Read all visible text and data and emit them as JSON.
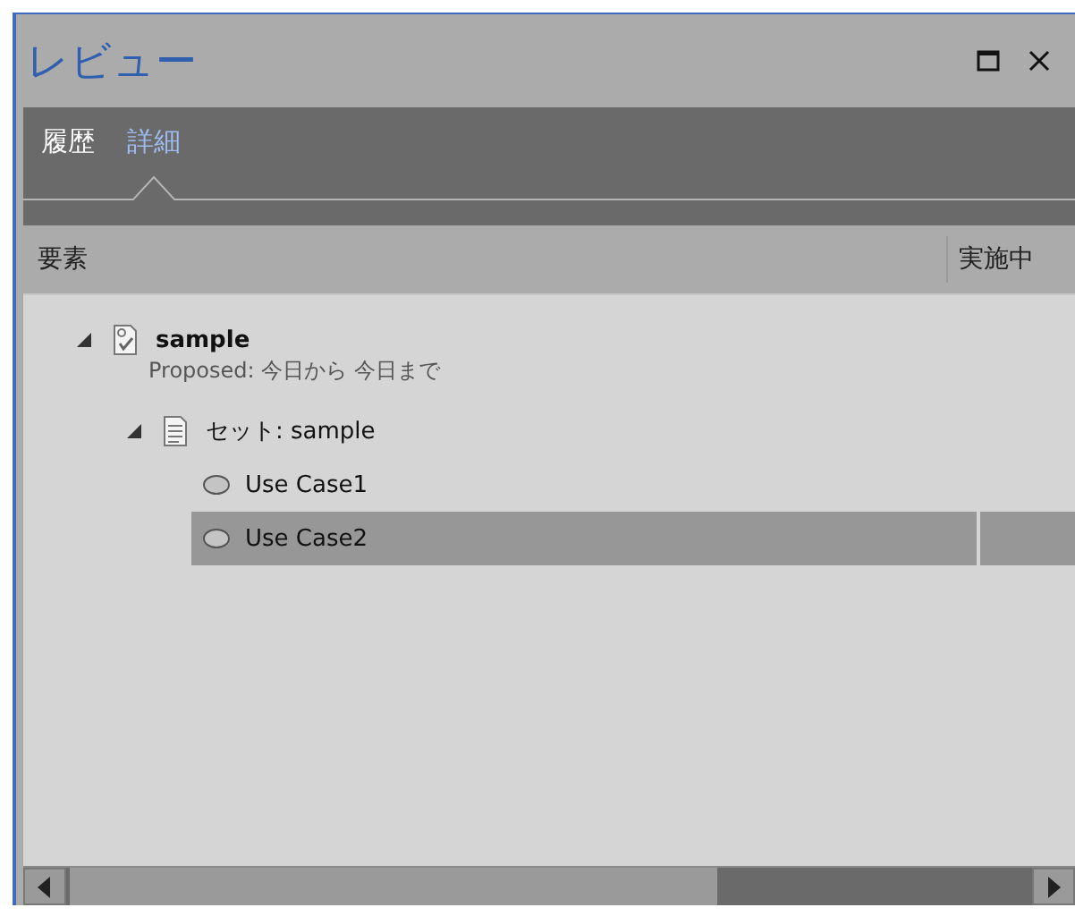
{
  "window": {
    "title": "レビュー"
  },
  "tabs": [
    {
      "label": "履歴",
      "selected": false
    },
    {
      "label": "詳細",
      "selected": true
    }
  ],
  "columns": [
    "要素",
    "実施中"
  ],
  "tree": [
    {
      "kind": "review",
      "label": "sample",
      "detail": "Proposed: 今日から 今日まで",
      "expanded": true,
      "selected": false,
      "children": [
        {
          "kind": "set",
          "label": "セット: sample",
          "expanded": true,
          "selected": false,
          "children": [
            {
              "kind": "usecase",
              "label": "Use Case1",
              "selected": false
            },
            {
              "kind": "usecase",
              "label": "Use Case2",
              "selected": true
            }
          ]
        }
      ]
    }
  ]
}
